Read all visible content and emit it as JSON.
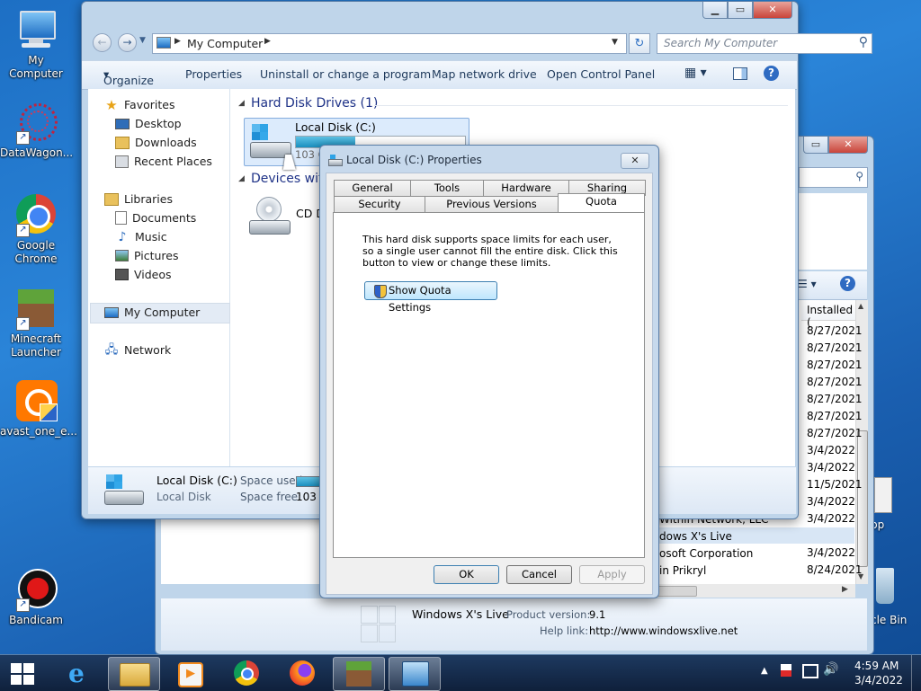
{
  "desktop": {
    "icons": [
      {
        "label": "My Computer"
      },
      {
        "label": "DataWagon..."
      },
      {
        "label": "Google Chrome"
      },
      {
        "label": "Minecraft Launcher"
      },
      {
        "label": "avast_one_e..."
      },
      {
        "label": "Bandicam"
      }
    ],
    "partial_icons": [
      {
        "label": "pp"
      },
      {
        "label": "cle Bin"
      }
    ]
  },
  "explorer": {
    "address": "My Computer",
    "search_placeholder": "Search My Computer",
    "toolbar": {
      "organize": "Organize",
      "properties": "Properties",
      "uninstall": "Uninstall or change a program",
      "map_drive": "Map network drive",
      "control_panel": "Open Control Panel"
    },
    "nav": {
      "favorites": "Favorites",
      "desktop": "Desktop",
      "downloads": "Downloads",
      "recent": "Recent Places",
      "libraries": "Libraries",
      "documents": "Documents",
      "music": "Music",
      "pictures": "Pictures",
      "videos": "Videos",
      "my_computer": "My Computer",
      "network": "Network"
    },
    "content": {
      "hdd_header": "Hard Disk Drives (1)",
      "disk_name": "Local Disk (C:)",
      "disk_free_partial": "103 G",
      "devices_header": "Devices wit",
      "cd_label": "CD D",
      "disk_fill_fraction": 0.35
    },
    "details": {
      "name": "Local Disk (C:)",
      "type": "Local Disk",
      "space_used_label": "Space used:",
      "space_free_label": "Space free:",
      "space_free_value": "103 G"
    }
  },
  "dialog": {
    "title": "Local Disk (C:) Properties",
    "tabs_row1": [
      "General",
      "Tools",
      "Hardware",
      "Sharing"
    ],
    "tabs_row2": [
      "Security",
      "Previous Versions",
      "Quota"
    ],
    "text": "This hard disk supports space limits for each user, so a single user cannot fill the entire disk. Click this button to view or change these limits.",
    "quota_button": "Show Quota Settings",
    "ok": "OK",
    "cancel": "Cancel",
    "apply": "Apply"
  },
  "programs": {
    "column_header": "Installed (",
    "installed_dates": [
      "8/27/2021",
      "8/27/2021",
      "8/27/2021",
      "8/27/2021",
      "8/27/2021",
      "8/27/2021",
      "8/27/2021",
      "3/4/2022",
      "3/4/2022",
      "11/5/2021",
      "3/4/2022",
      "3/4/2022",
      "3/4/2022",
      "3/4/2022",
      "8/24/2021"
    ],
    "publishers_partial": [
      "Within Network, LLC",
      "dows X's Live",
      "osoft Corporation",
      "in Prikryl"
    ],
    "bottom_name": "Windows X's Live",
    "product_version_label": "Product version:",
    "product_version": "9.1",
    "help_link_label": "Help link:",
    "help_link": "http://www.windowsxlive.net"
  },
  "taskbar": {
    "time": "4:59 AM",
    "date": "3/4/2022"
  }
}
